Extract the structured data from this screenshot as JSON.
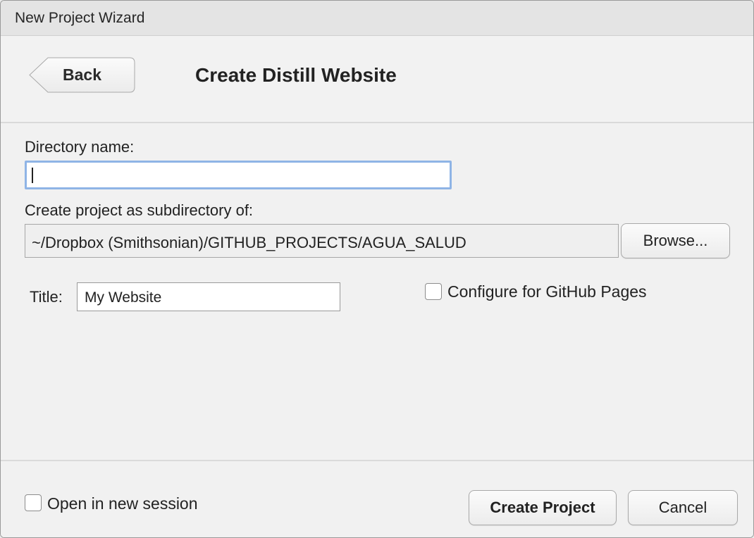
{
  "window": {
    "title": "New Project Wizard"
  },
  "header": {
    "back_label": "Back",
    "heading": "Create Distill Website"
  },
  "form": {
    "directory_label": "Directory name:",
    "directory_value": "",
    "subdirectory_label": "Create project as subdirectory of:",
    "subdirectory_value": "~/Dropbox (Smithsonian)/GITHUB_PROJECTS/AGUA_SALUD",
    "browse_label": "Browse...",
    "title_label": "Title:",
    "title_value": "My Website",
    "github_pages_label": "Configure for GitHub Pages",
    "github_pages_checked": false
  },
  "footer": {
    "new_session_label": "Open in new session",
    "new_session_checked": false,
    "create_label": "Create Project",
    "cancel_label": "Cancel"
  },
  "colors": {
    "focus_ring": "#8fb4e6",
    "window_bg": "#f1f1f1",
    "titlebar_bg": "#e4e4e4"
  }
}
